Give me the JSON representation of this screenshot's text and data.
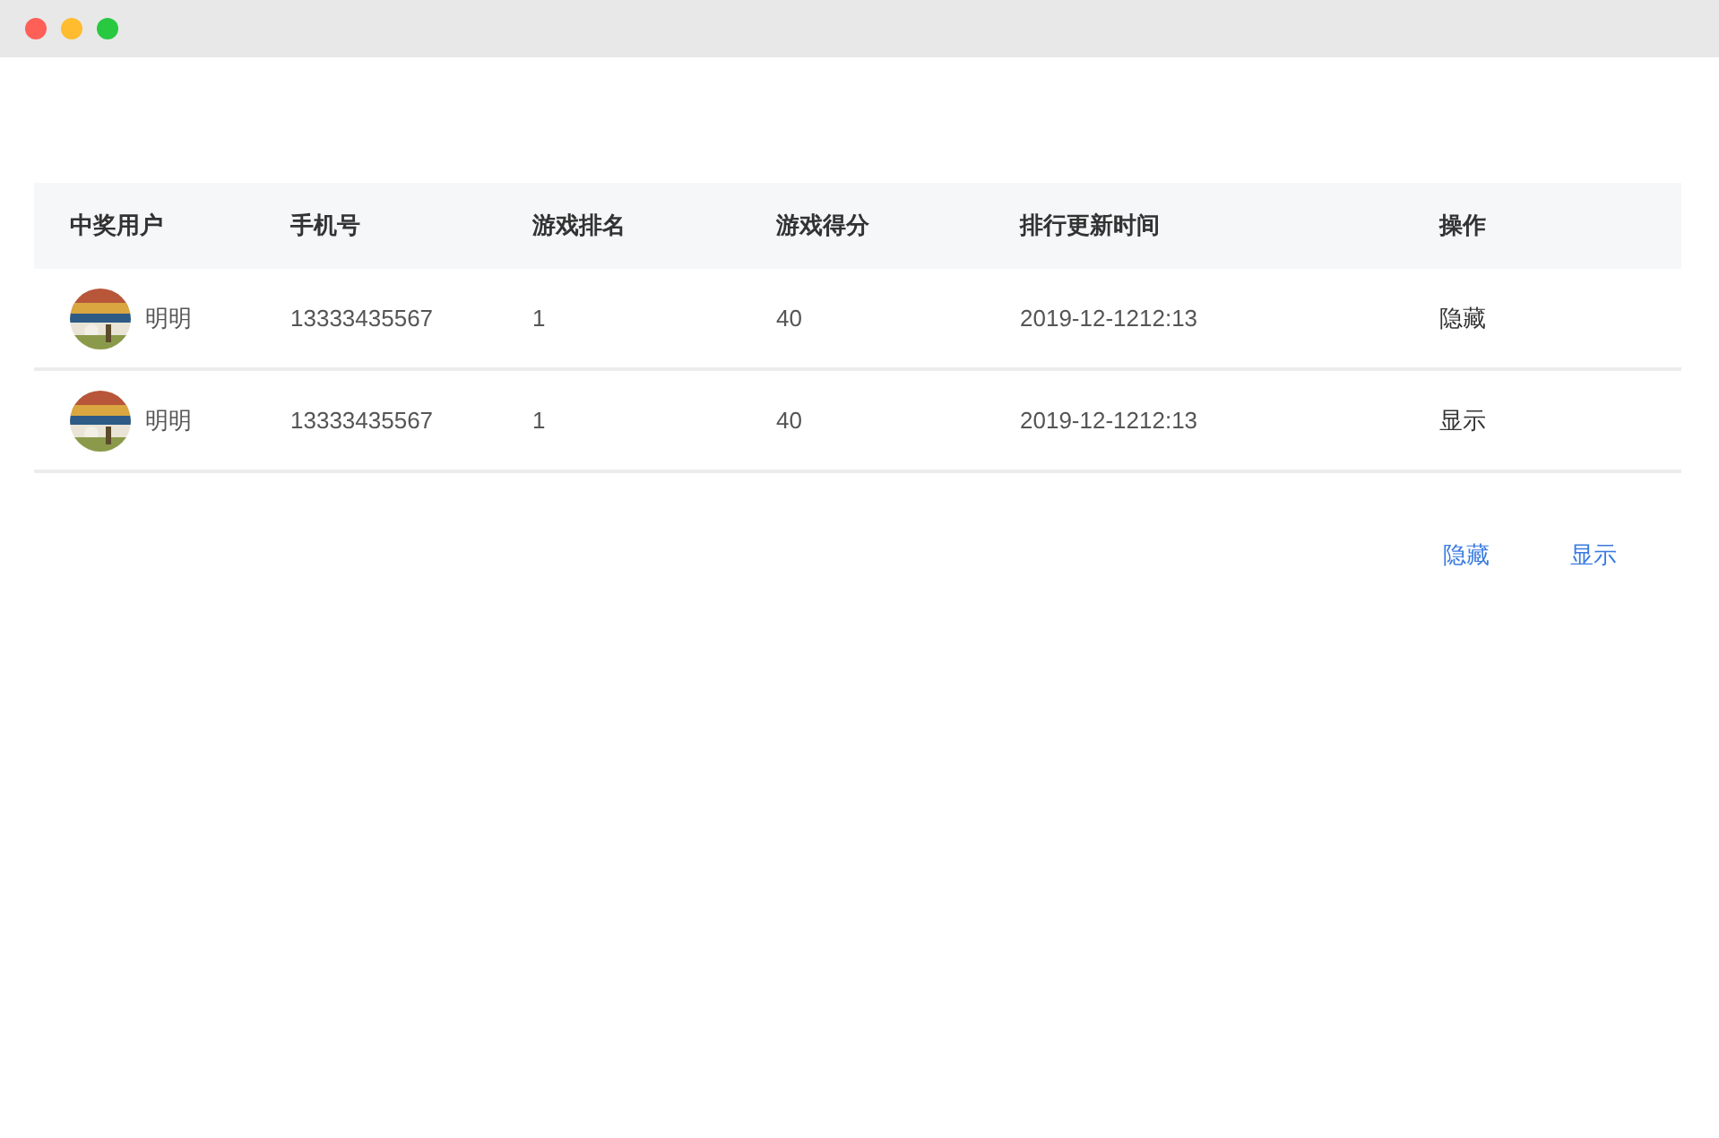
{
  "table": {
    "columns": [
      "中奖用户",
      "手机号",
      "游戏排名",
      "游戏得分",
      "排行更新时间",
      "操作"
    ],
    "rows": [
      {
        "user": "明明",
        "phone": "13333435567",
        "rank": "1",
        "score": "40",
        "updated": "2019-12-1212:13",
        "action": "隐藏"
      },
      {
        "user": "明明",
        "phone": "13333435567",
        "rank": "1",
        "score": "40",
        "updated": "2019-12-1212:13",
        "action": "显示"
      }
    ]
  },
  "actions": [
    "隐藏",
    "显示"
  ]
}
